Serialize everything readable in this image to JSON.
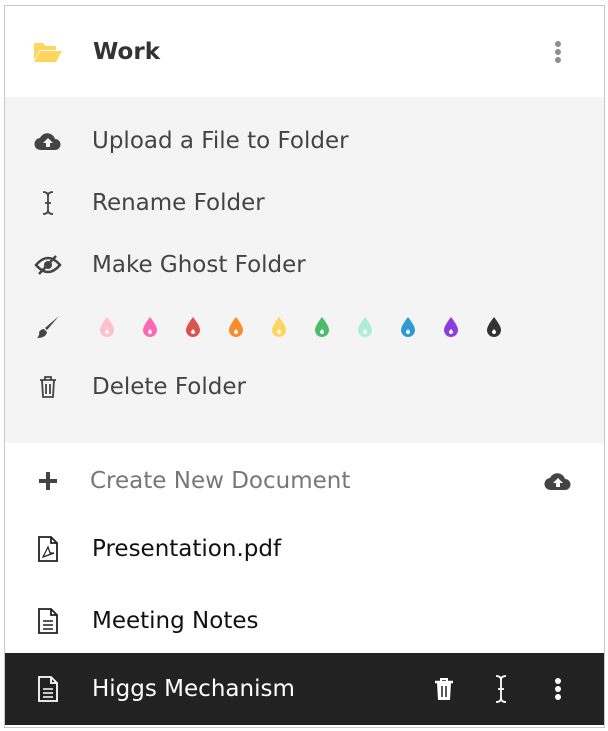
{
  "folder": {
    "name": "Work",
    "icon": "folder-open-icon",
    "color": "#ffd65c"
  },
  "menu": {
    "upload": "Upload a File to Folder",
    "rename": "Rename Folder",
    "ghost": "Make Ghost Folder",
    "delete": "Delete Folder",
    "colors": [
      "#ffc0cb",
      "#ff69b4",
      "#d9534f",
      "#f98b2a",
      "#ffd65c",
      "#4dbb6e",
      "#aeeed4",
      "#2f9ad0",
      "#8a3ee0",
      "#333333"
    ]
  },
  "documents": {
    "create": "Create New Document",
    "items": [
      {
        "name": "Presentation.pdf",
        "icon": "pdf-file-icon"
      },
      {
        "name": "Meeting Notes",
        "icon": "text-file-icon"
      },
      {
        "name": "Higgs Mechanism",
        "icon": "text-file-icon",
        "selected": true
      }
    ]
  }
}
